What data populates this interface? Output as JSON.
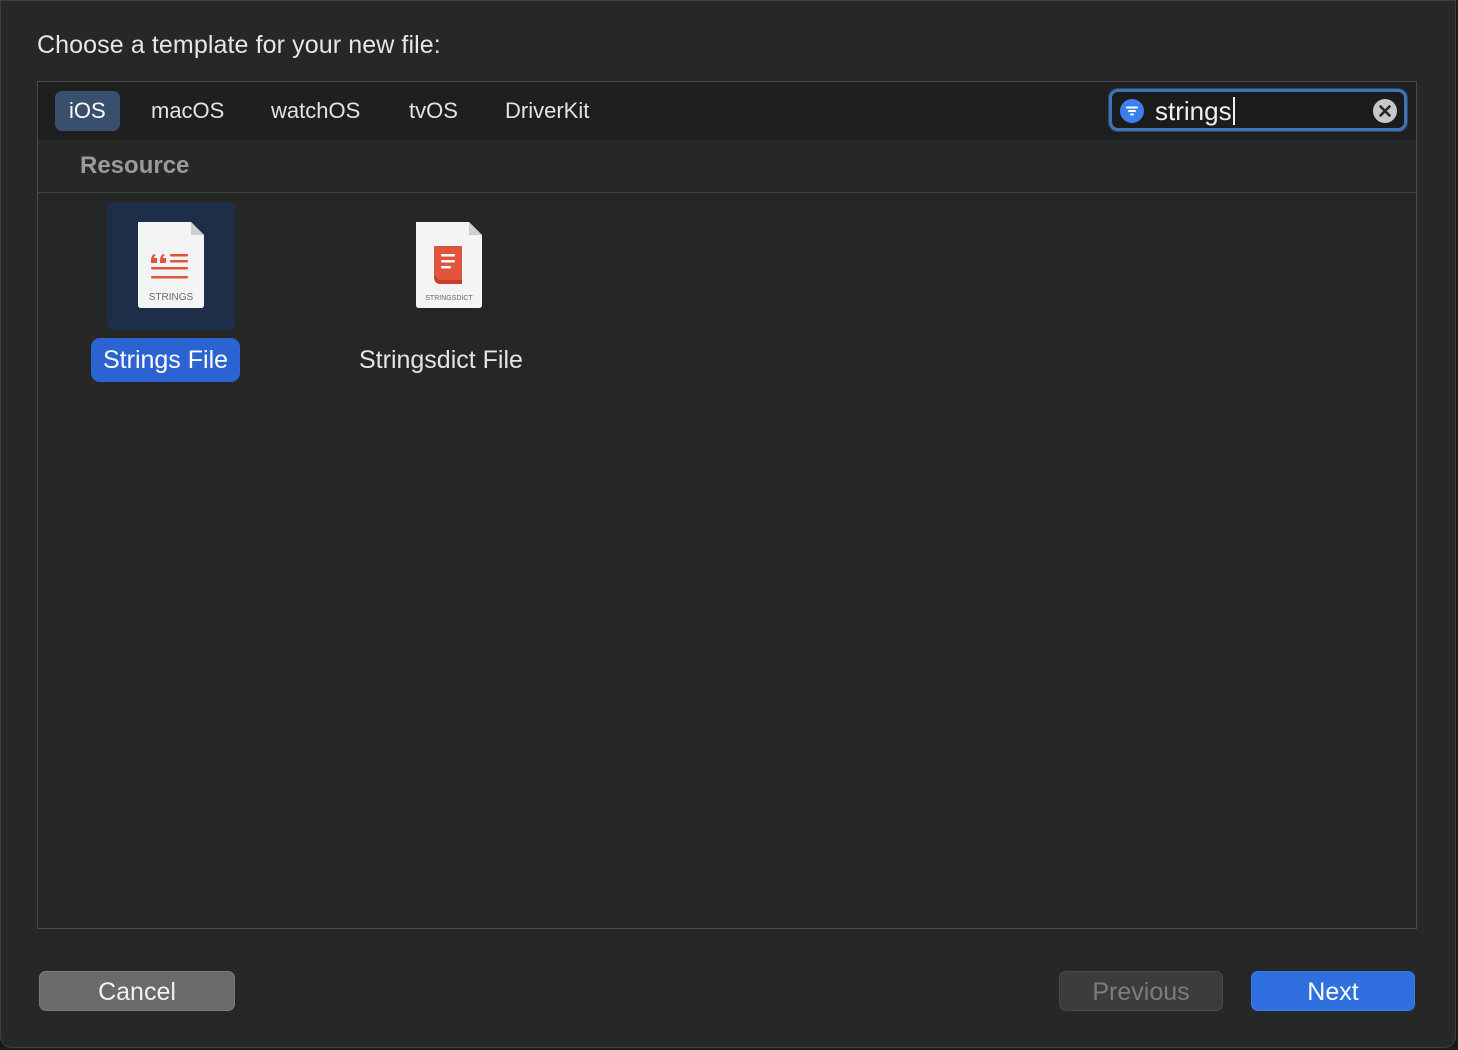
{
  "dialog": {
    "title": "Choose a template for your new file:"
  },
  "platform_tabs": [
    {
      "label": "iOS",
      "selected": true
    },
    {
      "label": "macOS",
      "selected": false
    },
    {
      "label": "watchOS",
      "selected": false
    },
    {
      "label": "tvOS",
      "selected": false
    },
    {
      "label": "DriverKit",
      "selected": false
    }
  ],
  "search": {
    "value": "strings",
    "icon": "filter-icon",
    "clear_icon": "clear-icon"
  },
  "section": {
    "label": "Resource"
  },
  "templates": [
    {
      "name": "Strings File",
      "icon": "strings-file-icon",
      "icon_badge": "STRINGS",
      "selected": true
    },
    {
      "name": "Stringsdict File",
      "icon": "stringsdict-file-icon",
      "icon_badge": "STRINGSDICT",
      "selected": false
    }
  ],
  "buttons": {
    "cancel": "Cancel",
    "previous": "Previous",
    "previous_enabled": false,
    "next": "Next"
  },
  "colors": {
    "accent": "#2c63d2",
    "icon_red": "#e2533c",
    "search_ring": "#3f75b4"
  }
}
